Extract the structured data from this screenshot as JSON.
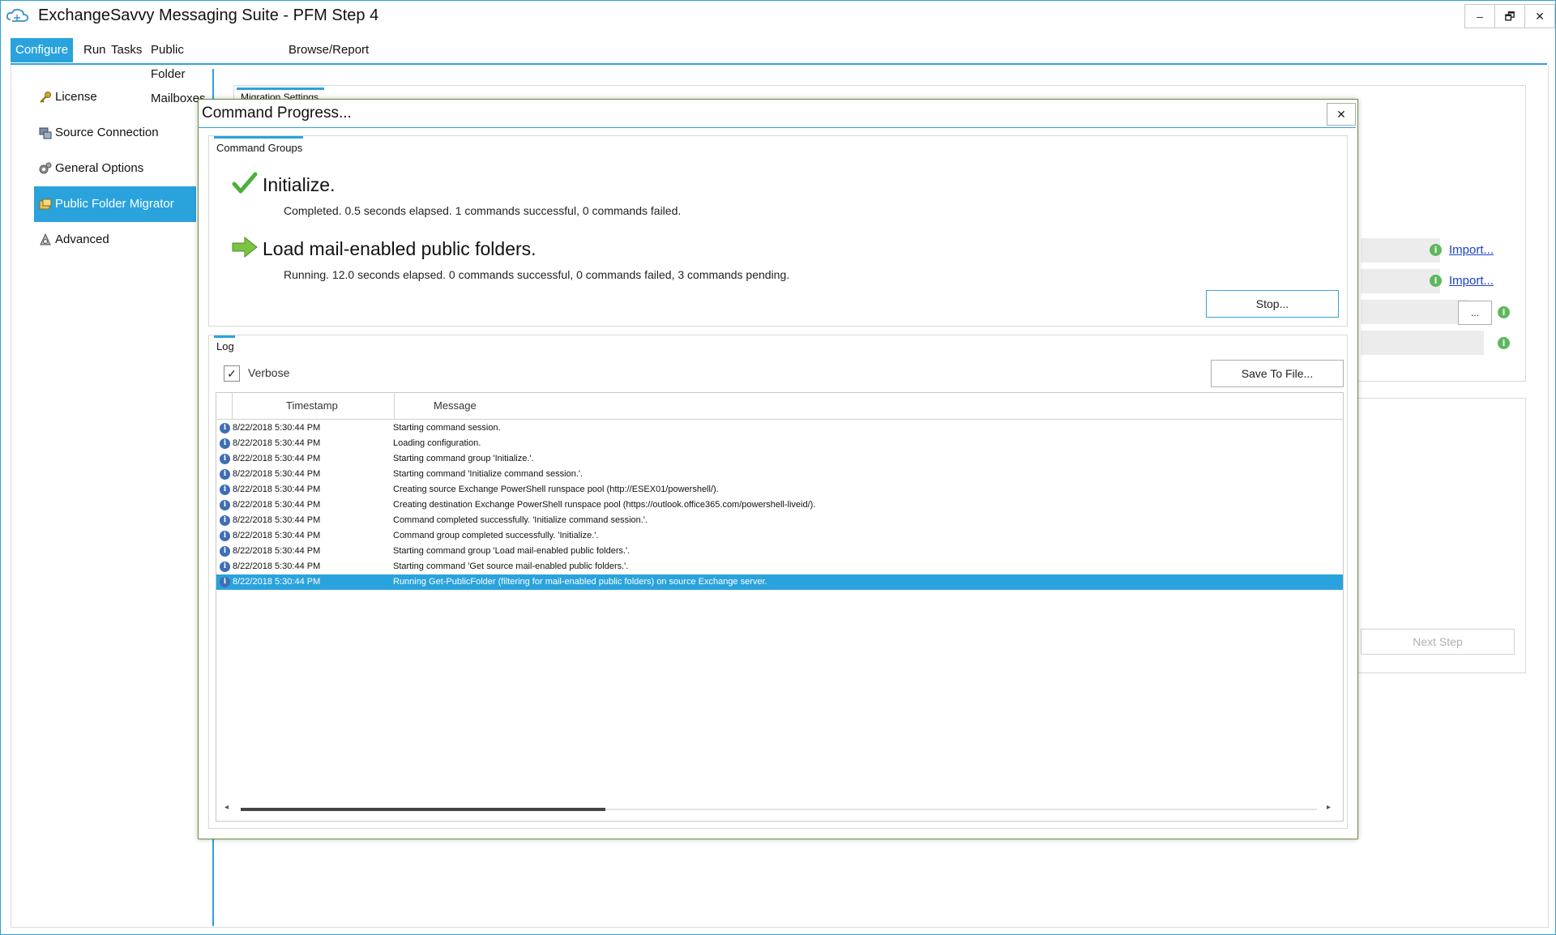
{
  "window": {
    "title": "ExchangeSavvy Messaging Suite - PFM Step 4",
    "minimize_glyph": "–",
    "restore_glyph": "🗗",
    "close_glyph": "✕"
  },
  "menu": {
    "items": [
      {
        "label": "Configure",
        "active": true
      },
      {
        "label": "Run"
      },
      {
        "label": "Tasks"
      },
      {
        "label": "Public Folder Mailboxes"
      },
      {
        "label": "Browse/Report"
      }
    ]
  },
  "sidebar": {
    "items": [
      {
        "label": "License",
        "icon": "key-icon"
      },
      {
        "label": "Source Connection",
        "icon": "server-connection-icon"
      },
      {
        "label": "General Options",
        "icon": "gears-icon"
      },
      {
        "label": "Public Folder Migrator",
        "icon": "folder-migrate-icon",
        "active": true
      },
      {
        "label": "Advanced",
        "icon": "advanced-icon"
      }
    ]
  },
  "background": {
    "tab_label": "Migration Settings",
    "import_link_1": "Import...",
    "import_link_2": "Import...",
    "browse_button": "...",
    "next_step_button": "Next Step",
    "info_glyph": "i"
  },
  "dialog": {
    "title": "Command Progress...",
    "close_glyph": "✕",
    "command_groups_tab": "Command Groups",
    "groups": [
      {
        "title": "Initialize.",
        "status": "Completed.  0.5 seconds elapsed.  1 commands successful, 0 commands failed.",
        "icon": "checkmark-icon"
      },
      {
        "title": "Load mail-enabled public folders.",
        "status": "Running.  12.0 seconds elapsed.  0 commands successful, 0 commands failed, 3 commands pending.",
        "icon": "arrow-right-icon"
      }
    ],
    "stop_button": "Stop...",
    "log_tab": "Log",
    "verbose_label": "Verbose",
    "verbose_checked": true,
    "save_button": "Save To File...",
    "log_columns": [
      "Timestamp",
      "Message"
    ],
    "log_rows": [
      {
        "ts": "8/22/2018 5:30:44 PM",
        "msg": "Starting command session."
      },
      {
        "ts": "8/22/2018 5:30:44 PM",
        "msg": "Loading configuration."
      },
      {
        "ts": "8/22/2018 5:30:44 PM",
        "msg": "Starting command group 'Initialize.'."
      },
      {
        "ts": "8/22/2018 5:30:44 PM",
        "msg": "Starting command 'Initialize command session.'."
      },
      {
        "ts": "8/22/2018 5:30:44 PM",
        "msg": "Creating source Exchange PowerShell runspace pool (http://ESEX01/powershell/)."
      },
      {
        "ts": "8/22/2018 5:30:44 PM",
        "msg": "Creating destination Exchange PowerShell runspace pool (https://outlook.office365.com/powershell-liveid/)."
      },
      {
        "ts": "8/22/2018 5:30:44 PM",
        "msg": "Command completed successfully.  'Initialize command session.'."
      },
      {
        "ts": "8/22/2018 5:30:44 PM",
        "msg": "Command group completed successfully.  'Initialize.'."
      },
      {
        "ts": "8/22/2018 5:30:44 PM",
        "msg": "Starting command group 'Load mail-enabled public folders.'."
      },
      {
        "ts": "8/22/2018 5:30:44 PM",
        "msg": "Starting command 'Get source mail-enabled public folders.'."
      },
      {
        "ts": "8/22/2018 5:30:44 PM",
        "msg": "Running Get-PublicFolder (filtering for mail-enabled public folders) on source Exchange server.",
        "selected": true
      }
    ],
    "row_info_glyph": "i",
    "scroll_left_glyph": "◂",
    "scroll_right_glyph": "▸"
  },
  "colors": {
    "accent": "#2aa3dd",
    "success": "#5cb85c",
    "dialog_border": "#6d8f3f"
  }
}
